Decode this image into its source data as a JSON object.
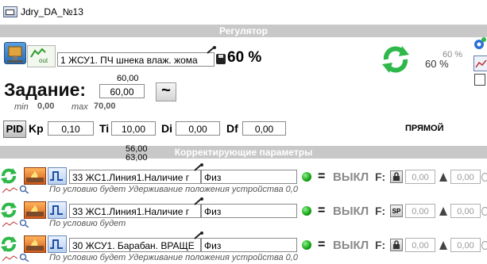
{
  "window": {
    "title": "Jdry_DA_№13"
  },
  "regulator": {
    "section_title": "Регулятор",
    "channel_name": "1 ЖСУ1. ПЧ шнека влаж. жома",
    "output_value": "60 %",
    "right_value": "60 %",
    "right_value_faded": "60 %",
    "out_label": "out"
  },
  "setpoint": {
    "label": "Задание:",
    "top_value": "60,00",
    "value": "60,00",
    "min_label": "min",
    "min_value": "0,00",
    "max_label": "max",
    "max_value": "70,00",
    "tilde": "~"
  },
  "pid": {
    "button_label": "PID",
    "kp_label": "Kp",
    "kp_value": "0,10",
    "ti_label": "Ti",
    "ti_value": "10,00",
    "di_label": "Di",
    "di_value": "0,00",
    "df_label": "Df",
    "df_value": "0,00",
    "mode": "ПРЯМОЙ"
  },
  "correction": {
    "section_title": "Корректирующие параметры",
    "overlay_values": [
      "56,00",
      "63,00"
    ],
    "rows": [
      {
        "channel": "33 ЖС1.Линия1.Наличие г",
        "type": "Физ",
        "eq": "=",
        "state": "ВЫКЛ",
        "f_label": "F:",
        "f_value": "0,00",
        "d_value": "0,00",
        "note": "По условию будет Удерживание положения устройства 0,0"
      },
      {
        "channel": "33 ЖС1.Линия1.Наличие г",
        "type": "Физ",
        "eq": "=",
        "state": "ВЫКЛ",
        "f_label": "F:",
        "f_button": "SP",
        "f_value": "0,00",
        "d_value": "0,00",
        "note": "По условию будет"
      },
      {
        "channel": "30 ЖСУ1. Барабан. ВРАЩЕ",
        "type": "Физ",
        "eq": "=",
        "state": "ВЫКЛ",
        "f_label": "F:",
        "f_value": "0,00",
        "d_value": "0,00",
        "note": "По условию будет Удерживание положения устройства 0,0"
      }
    ]
  }
}
